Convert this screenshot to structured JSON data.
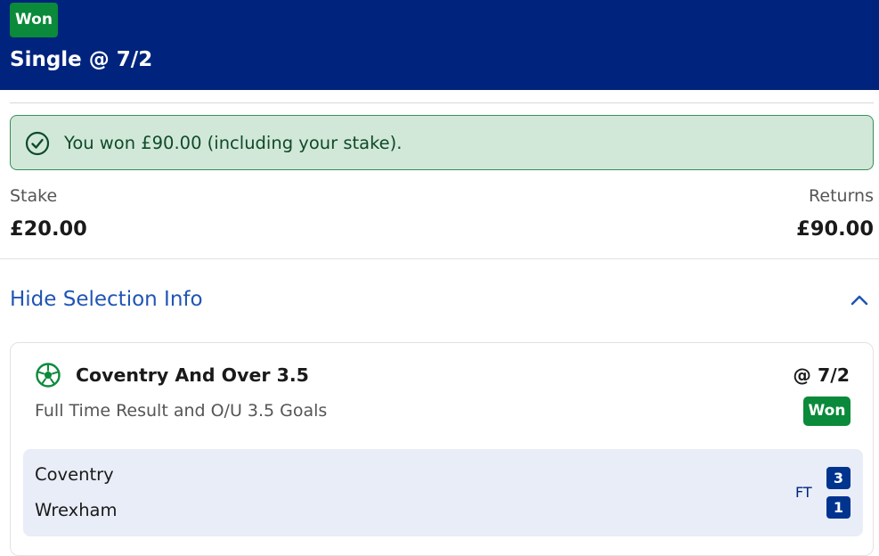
{
  "header": {
    "status": "Won",
    "title": "Single @ 7/2",
    "background_color": "#00247e",
    "status_color": "#0a8a3a"
  },
  "win_banner": {
    "icon": "check-circle-icon",
    "message": "You won £90.00 (including your stake)."
  },
  "summary": {
    "stake_label": "Stake",
    "stake_value": "£20.00",
    "returns_label": "Returns",
    "returns_value": "£90.00"
  },
  "selection_toggle": {
    "label": "Hide Selection Info",
    "icon": "chevron-up-icon"
  },
  "selection": {
    "sport_icon": "football-icon",
    "name": "Coventry And Over 3.5",
    "odds": "@ 7/2",
    "market": "Full Time Result and O/U 3.5 Goals",
    "status": "Won"
  },
  "score": {
    "home_team": "Coventry",
    "away_team": "Wrexham",
    "period": "FT",
    "home_score": "3",
    "away_score": "1"
  }
}
